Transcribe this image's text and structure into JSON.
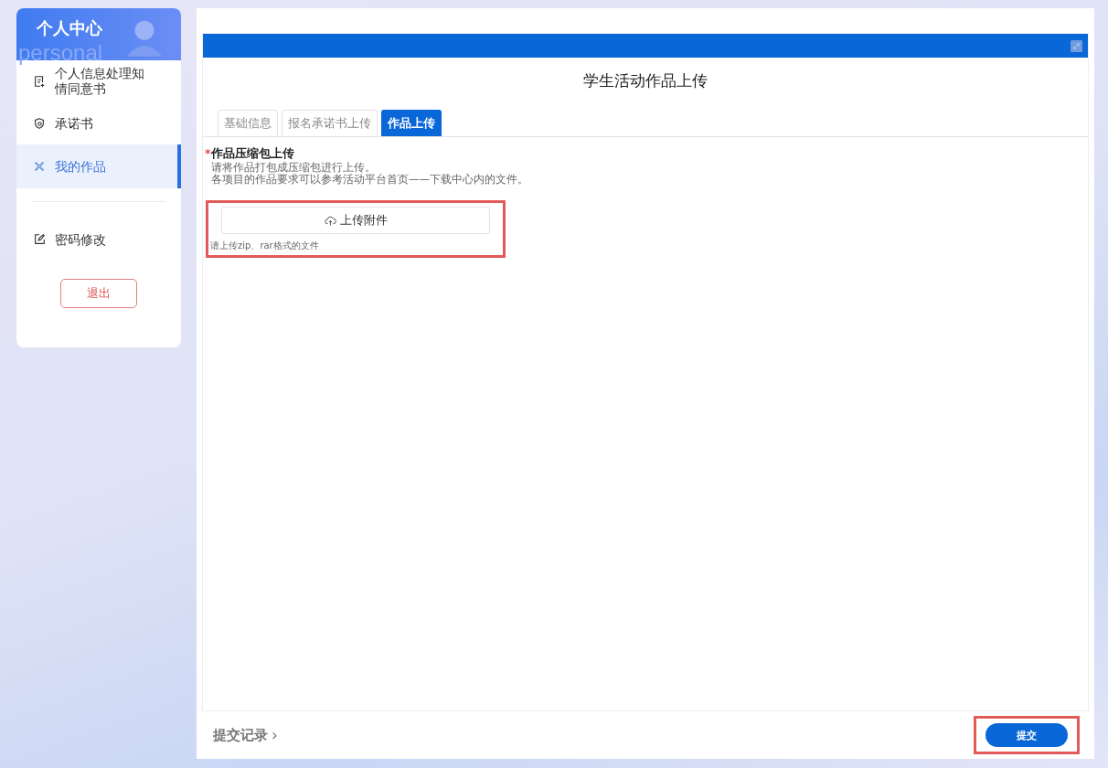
{
  "sidebar": {
    "title": "个人中心",
    "watermark": "personal",
    "items": [
      {
        "label": "个人信息处理知情同意书",
        "selected": false
      },
      {
        "label": "承诺书",
        "selected": false
      },
      {
        "label": "我的作品",
        "selected": true
      }
    ],
    "secondary_items": [
      {
        "label": "密码修改",
        "selected": false
      }
    ],
    "logout": "退出"
  },
  "page": {
    "title": "学生活动作品上传",
    "tabs": [
      {
        "label": "基础信息",
        "selected": false
      },
      {
        "label": "报名承诺书上传",
        "selected": false
      },
      {
        "label": "作品上传",
        "selected": true
      }
    ],
    "field": {
      "required_mark": "*",
      "label": "作品压缩包上传",
      "hints": [
        "请将作品打包成压缩包进行上传。",
        "各项目的作品要求可以参考活动平台首页——下载中心内的文件。"
      ],
      "upload_button": "上传附件",
      "note": "请上传zip、rar格式的文件",
      "highlighted": true
    }
  },
  "footer": {
    "history_link": "提交记录",
    "chevron": "›",
    "submit": "提交",
    "submit_highlighted": true
  }
}
